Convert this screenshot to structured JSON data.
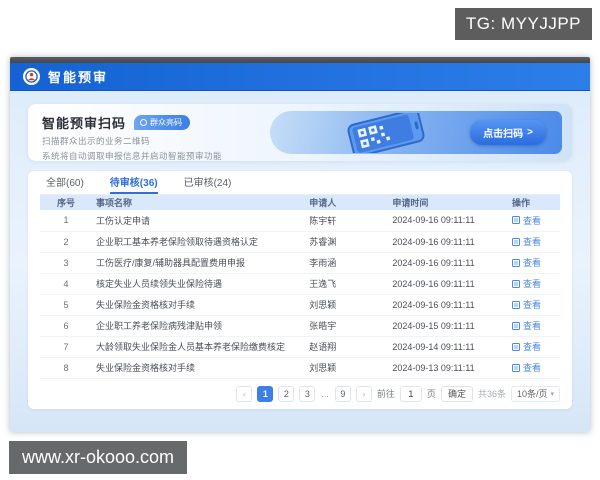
{
  "overlay": {
    "tg_badge": "TG: MYYJJPP",
    "site_badge": "www.xr-okooo.com"
  },
  "app": {
    "title": "智能预审"
  },
  "banner": {
    "title": "智能预审扫码",
    "badge": "群众亮码",
    "desc1": "扫描群众出示的业务二维码",
    "desc2": "系统将自动调取申报信息并启动智能预审功能",
    "scan_button": "点击扫码"
  },
  "tabs": [
    {
      "label": "全部(60)"
    },
    {
      "label": "待审核(36)"
    },
    {
      "label": "已审核(24)"
    }
  ],
  "table": {
    "columns": [
      "序号",
      "事项名称",
      "申请人",
      "申请时间",
      "操作"
    ],
    "action_label": "查看",
    "rows": [
      {
        "no": "1",
        "item": "工伤认定申请",
        "applicant": "陈宇轩",
        "time": "2024-09-16 09:11:11"
      },
      {
        "no": "2",
        "item": "企业职工基本养老保险领取待遇资格认定",
        "applicant": "苏睿渊",
        "time": "2024-09-16 09:11:11"
      },
      {
        "no": "3",
        "item": "工伤医疗/康复/辅助器具配置费用申报",
        "applicant": "李雨涵",
        "time": "2024-09-16 09:11:11"
      },
      {
        "no": "4",
        "item": "核定失业人员续领失业保险待遇",
        "applicant": "王逸飞",
        "time": "2024-09-16 09:11:11"
      },
      {
        "no": "5",
        "item": "失业保险金资格核对手续",
        "applicant": "刘思颖",
        "time": "2024-09-16 09:11:11"
      },
      {
        "no": "6",
        "item": "企业职工养老保险病残津贴申领",
        "applicant": "张皓宇",
        "time": "2024-09-15 09:11:11"
      },
      {
        "no": "7",
        "item": "大龄领取失业保险金人员基本养老保险缴费核定",
        "applicant": "赵语翔",
        "time": "2024-09-14 09:11:11"
      },
      {
        "no": "8",
        "item": "失业保险金资格核对手续",
        "applicant": "刘思颖",
        "time": "2024-09-13 09:11:11"
      }
    ]
  },
  "pagination": {
    "pages": [
      "1",
      "2",
      "3",
      "...",
      "9"
    ],
    "jump_label": "前往",
    "jump_value": "1",
    "jump_unit": "页",
    "confirm": "确定",
    "total": "共36条",
    "page_size": "10条/页"
  },
  "icons": {
    "prev": "‹",
    "next": "›",
    "caret": "▾",
    "arrow_right": ">"
  },
  "colors": {
    "header_blue": "#1462d3",
    "accent": "#3d7ee8",
    "link": "#4a87e8",
    "table_header_bg": "#d9e8fb",
    "badge_gray": "#5d5d5d"
  }
}
